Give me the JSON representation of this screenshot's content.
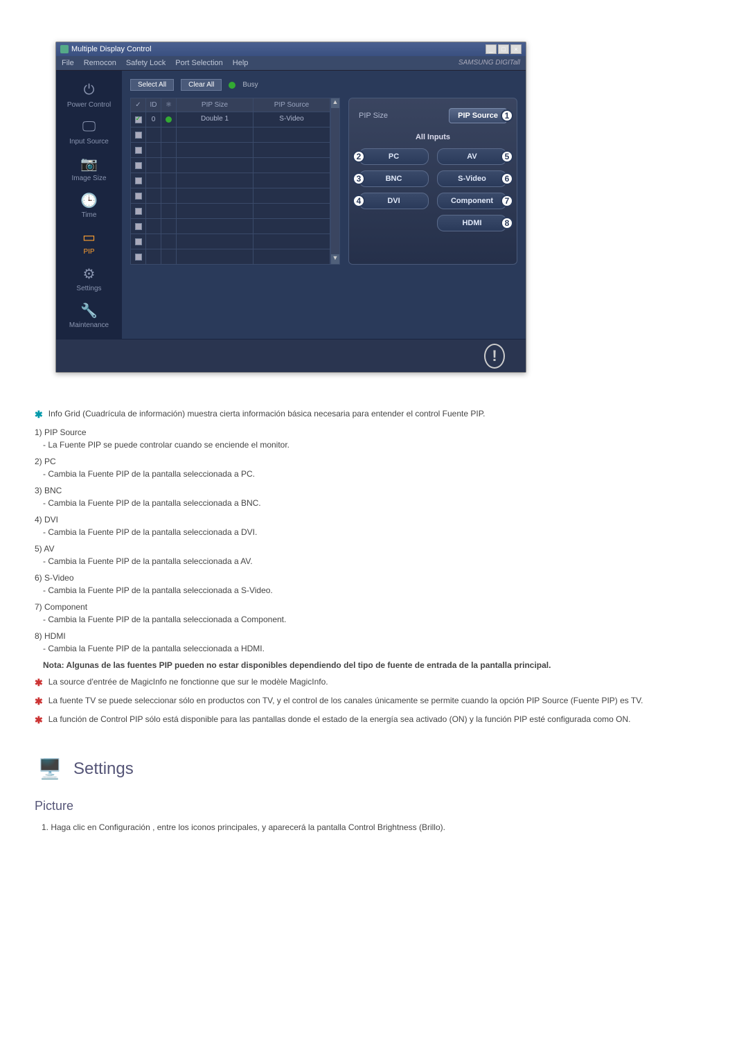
{
  "app": {
    "title": "Multiple Display Control",
    "brand": "SAMSUNG DIGITall",
    "menu": [
      "File",
      "Remocon",
      "Safety Lock",
      "Port Selection",
      "Help"
    ],
    "toolbar": {
      "select_all": "Select All",
      "clear_all": "Clear All",
      "busy": "Busy"
    },
    "sidebar": [
      {
        "label": "Power Control"
      },
      {
        "label": "Input Source"
      },
      {
        "label": "Image Size"
      },
      {
        "label": "Time"
      },
      {
        "label": "PIP"
      },
      {
        "label": "Settings"
      },
      {
        "label": "Maintenance"
      }
    ],
    "active_sidebar": "PIP",
    "grid": {
      "headers": {
        "chk": "✓",
        "id": "ID",
        "status": "",
        "pipsize": "PIP Size",
        "pipsrc": "PIP Source"
      },
      "rows": [
        {
          "checked": true,
          "id": "0",
          "status": "ok",
          "pipsize": "Double 1",
          "pipsrc": "S-Video"
        },
        {
          "checked": false,
          "id": "",
          "status": "",
          "pipsize": "",
          "pipsrc": ""
        },
        {
          "checked": false,
          "id": "",
          "status": "",
          "pipsize": "",
          "pipsrc": ""
        },
        {
          "checked": false,
          "id": "",
          "status": "",
          "pipsize": "",
          "pipsrc": ""
        },
        {
          "checked": false,
          "id": "",
          "status": "",
          "pipsize": "",
          "pipsrc": ""
        },
        {
          "checked": false,
          "id": "",
          "status": "",
          "pipsize": "",
          "pipsrc": ""
        },
        {
          "checked": false,
          "id": "",
          "status": "",
          "pipsize": "",
          "pipsrc": ""
        },
        {
          "checked": false,
          "id": "",
          "status": "",
          "pipsize": "",
          "pipsrc": ""
        },
        {
          "checked": false,
          "id": "",
          "status": "",
          "pipsize": "",
          "pipsrc": ""
        },
        {
          "checked": false,
          "id": "",
          "status": "",
          "pipsize": "",
          "pipsrc": ""
        }
      ]
    },
    "control": {
      "head_label": "PIP Size",
      "head_btn": "PIP Source",
      "all_inputs": "All Inputs",
      "buttons": [
        {
          "label": "PC",
          "num": "2",
          "side": "left"
        },
        {
          "label": "AV",
          "num": "5",
          "side": "right"
        },
        {
          "label": "BNC",
          "num": "3",
          "side": "left"
        },
        {
          "label": "S-Video",
          "num": "6",
          "side": "right"
        },
        {
          "label": "DVI",
          "num": "4",
          "side": "left"
        },
        {
          "label": "Component",
          "num": "7",
          "side": "right"
        },
        {
          "label": "",
          "num": "",
          "side": ""
        },
        {
          "label": "HDMI",
          "num": "8",
          "side": "right"
        }
      ],
      "badge_head": "1"
    }
  },
  "notes": {
    "intro": "Info Grid (Cuadrícula de información) muestra cierta información básica necesaria para entender el control Fuente PIP.",
    "items": [
      {
        "n": "1)",
        "label": "PIP Source",
        "desc": "- La Fuente PIP se puede controlar cuando se enciende el monitor."
      },
      {
        "n": "2)",
        "label": "PC",
        "desc": "- Cambia la Fuente PIP de la pantalla seleccionada a PC."
      },
      {
        "n": "3)",
        "label": "BNC",
        "desc": "- Cambia la Fuente PIP de la pantalla seleccionada a BNC."
      },
      {
        "n": "4)",
        "label": "DVI",
        "desc": "- Cambia la Fuente PIP de la pantalla seleccionada a DVI."
      },
      {
        "n": "5)",
        "label": "AV",
        "desc": "- Cambia la Fuente PIP de la pantalla seleccionada a AV."
      },
      {
        "n": "6)",
        "label": "S-Video",
        "desc": "- Cambia la Fuente PIP de la pantalla seleccionada a S-Video."
      },
      {
        "n": "7)",
        "label": "Component",
        "desc": "- Cambia la Fuente PIP de la pantalla seleccionada a Component."
      },
      {
        "n": "8)",
        "label": "HDMI",
        "desc": "- Cambia la Fuente PIP de la pantalla seleccionada a HDMI."
      }
    ],
    "nota": "Nota: Algunas de las fuentes PIP pueden no estar disponibles dependiendo del tipo de fuente de entrada de la pantalla principal.",
    "red": [
      "La source d'entrée de MagicInfo ne fonctionne que sur le modèle MagicInfo.",
      "La fuente TV se puede seleccionar sólo en productos con TV, y el control de los canales únicamente se permite cuando la opción PIP Source (Fuente PIP) es TV.",
      "La función de Control PIP sólo está disponible para las pantallas donde el estado de la energía sea activado (ON) y la función PIP esté configurada como ON."
    ]
  },
  "section": {
    "title": "Settings",
    "subtitle": "Picture",
    "step": "1. Haga clic en Configuración , entre los iconos principales, y aparecerá la pantalla Control Brightness (Brillo)."
  }
}
